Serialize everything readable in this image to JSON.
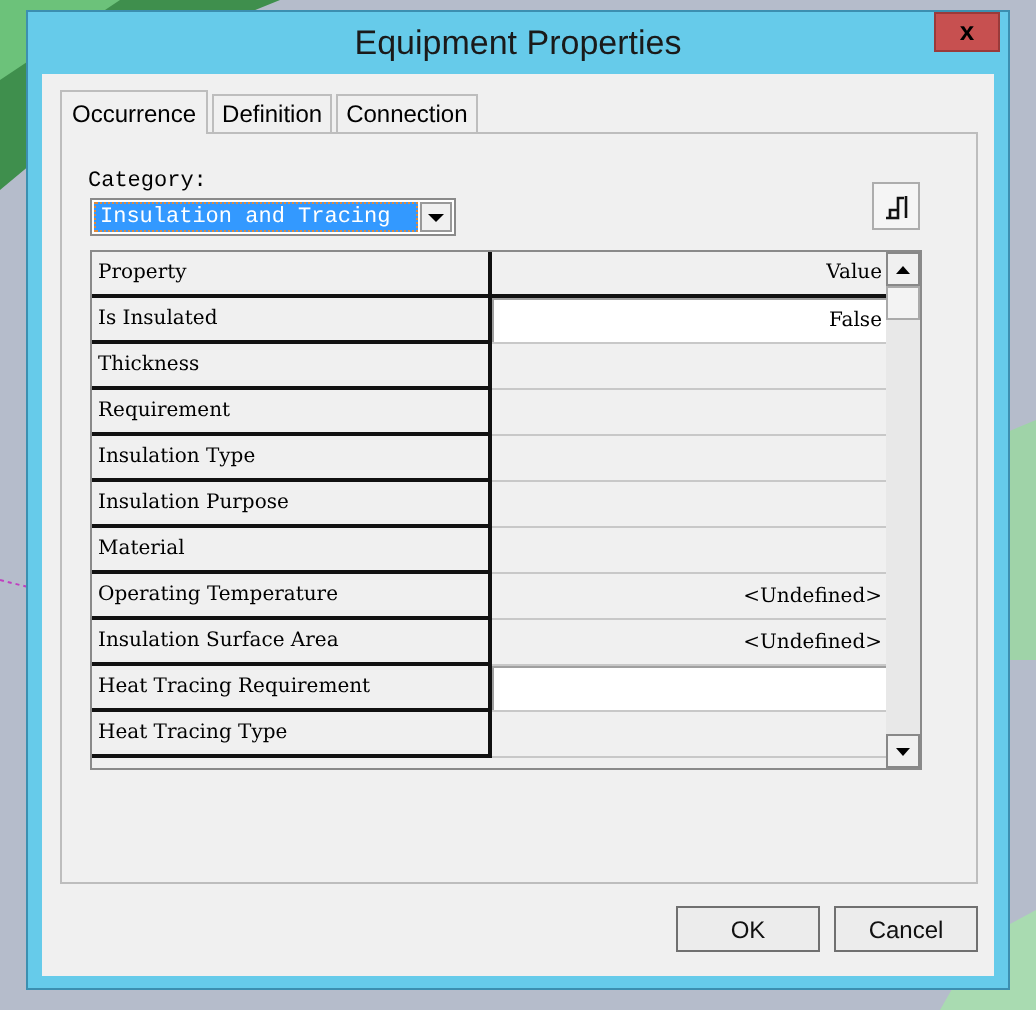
{
  "window": {
    "title": "Equipment Properties",
    "close": "x"
  },
  "tabs": [
    {
      "label": "Occurrence",
      "selected": true
    },
    {
      "label": "Definition",
      "selected": false
    },
    {
      "label": "Connection",
      "selected": false
    }
  ],
  "category": {
    "label": "Category:",
    "value": "Insulation and Tracing"
  },
  "table": {
    "columns": [
      "Property",
      "Value"
    ],
    "rows": [
      {
        "property": "Is Insulated",
        "value": "False",
        "editable": true
      },
      {
        "property": "Thickness",
        "value": "",
        "editable": false
      },
      {
        "property": "Requirement",
        "value": "",
        "editable": false
      },
      {
        "property": "Insulation Type",
        "value": "",
        "editable": false
      },
      {
        "property": "Insulation Purpose",
        "value": "",
        "editable": false
      },
      {
        "property": "Material",
        "value": "",
        "editable": false
      },
      {
        "property": "Operating Temperature",
        "value": "<Undefined>",
        "editable": false
      },
      {
        "property": "Insulation Surface Area",
        "value": "<Undefined>",
        "editable": false
      },
      {
        "property": "Heat Tracing Requirement",
        "value": "",
        "editable": true
      },
      {
        "property": "Heat Tracing Type",
        "value": "",
        "editable": false
      }
    ]
  },
  "buttons": [
    "OK",
    "Cancel"
  ]
}
